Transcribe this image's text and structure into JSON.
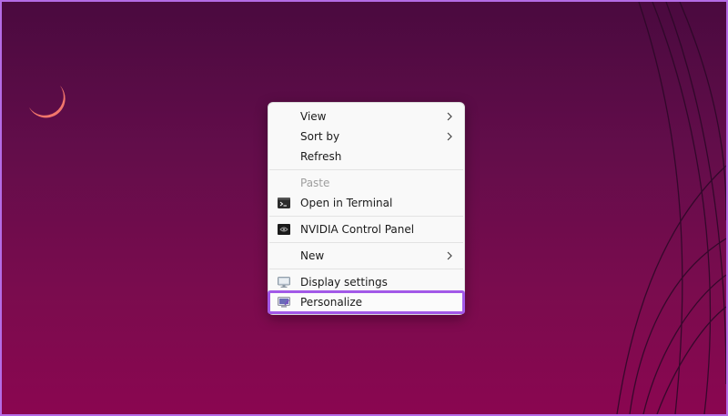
{
  "context_menu": {
    "items": [
      {
        "label": "View",
        "has_submenu": true
      },
      {
        "label": "Sort by",
        "has_submenu": true
      },
      {
        "label": "Refresh"
      },
      {
        "label": "Paste",
        "disabled": true
      },
      {
        "label": "Open in Terminal",
        "icon": "terminal-icon"
      },
      {
        "label": "NVIDIA Control Panel",
        "icon": "nvidia-icon"
      },
      {
        "label": "New",
        "has_submenu": true
      },
      {
        "label": "Display settings",
        "icon": "display-icon"
      },
      {
        "label": "Personalize",
        "icon": "personalize-icon",
        "highlighted": true
      }
    ]
  },
  "desktop": {
    "icon": "moon-icon"
  },
  "colors": {
    "background_top": "#4a0a3f",
    "background_bottom": "#8a0650",
    "highlight_border": "#a259e8",
    "moon": "#f2766b"
  }
}
